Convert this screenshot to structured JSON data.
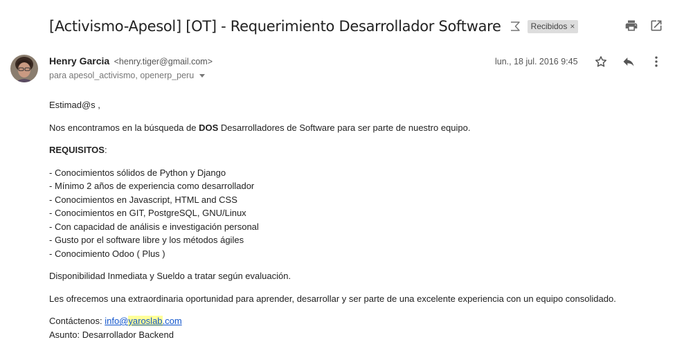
{
  "header": {
    "subject": "[Activismo-Apesol] [OT] - Requerimiento Desarrollador Software",
    "label": "Recibidos",
    "label_remove": "×",
    "icons": [
      "importance-marker-icon",
      "print-icon",
      "open-new-window-icon"
    ]
  },
  "message": {
    "sender_name": "Henry Garcia",
    "sender_email": "<henry.tiger@gmail.com>",
    "recipients": "para apesol_activismo, openerp_peru",
    "date": "lun., 18 jul. 2016 9:45",
    "icons": [
      "avatar",
      "star-icon",
      "reply-icon",
      "more-options-icon"
    ]
  },
  "body": {
    "greeting": "Estimad@s ,",
    "intro_pre": "Nos encontramos en la búsqueda de ",
    "intro_bold": "DOS",
    "intro_post": " Desarrolladores de Software para ser parte de nuestro equipo.",
    "req_title": "REQUISITOS",
    "req_colon": ":",
    "requirements": [
      "- Conocimientos sólidos de Python y Django",
      "- Mínimo 2 años de experiencia como desarrollador",
      "- Conocimientos en Javascript, HTML and CSS",
      "- Conocimientos en GIT, PostgreSQL, GNU/Linux",
      "- Con capacidad de análisis e investigación personal",
      "- Gusto por el software libre y los métodos ágiles",
      "- Conocimiento Odoo ( Plus )"
    ],
    "availability": "Disponibilidad Inmediata y Sueldo a tratar según evaluación.",
    "offer": "Les ofrecemos una extraordinaria oportunidad para aprender, desarrollar y ser parte de una excelente experiencia con un equipo consolidado.",
    "contact_label": "Contáctenos: ",
    "contact_link_pre": "info@",
    "contact_link_hl": "yaroslab",
    "contact_link_post": ".com",
    "subject_line": "Asunto: Desarrollador Backend"
  },
  "colors": {
    "link": "#1155cc",
    "highlight": "#ffff99",
    "chip_bg": "#dddddd"
  }
}
